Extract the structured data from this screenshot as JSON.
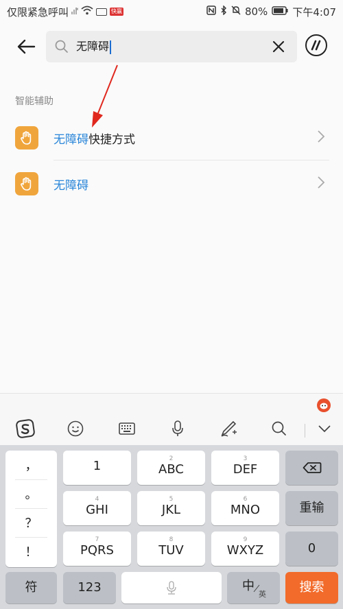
{
  "status_bar": {
    "carrier": "仅限紧急呼叫",
    "app_tag": "快赢",
    "battery": "80%",
    "time": "下午4:07"
  },
  "search": {
    "query": "无障碍",
    "back_icon": "arrow-left-icon",
    "search_icon": "magnifier-icon",
    "clear_icon": "close-icon"
  },
  "section": {
    "title": "智能辅助"
  },
  "results": [
    {
      "highlight": "无障碍",
      "rest": "快捷方式",
      "icon": "hand-icon"
    },
    {
      "highlight": "无障碍",
      "rest": "",
      "icon": "hand-icon"
    }
  ],
  "keyboard": {
    "punctuation": [
      "，",
      "。",
      "？",
      "！"
    ],
    "rows": [
      [
        {
          "num": "",
          "label": "1"
        },
        {
          "num": "2",
          "label": "ABC"
        },
        {
          "num": "3",
          "label": "DEF"
        }
      ],
      [
        {
          "num": "4",
          "label": "GHI"
        },
        {
          "num": "5",
          "label": "JKL"
        },
        {
          "num": "6",
          "label": "MNO"
        }
      ],
      [
        {
          "num": "7",
          "label": "PQRS"
        },
        {
          "num": "8",
          "label": "TUV"
        },
        {
          "num": "9",
          "label": "WXYZ"
        }
      ]
    ],
    "right_keys": {
      "redo": "重输",
      "zero": "0"
    },
    "bottom": {
      "symbol": "符",
      "num": "123",
      "lang_main": "中",
      "lang_sub": "英",
      "search": "搜索"
    }
  },
  "colors": {
    "accent": "#2a86d9",
    "icon_bg": "#f0a53c",
    "search_key": "#f26b2a"
  }
}
